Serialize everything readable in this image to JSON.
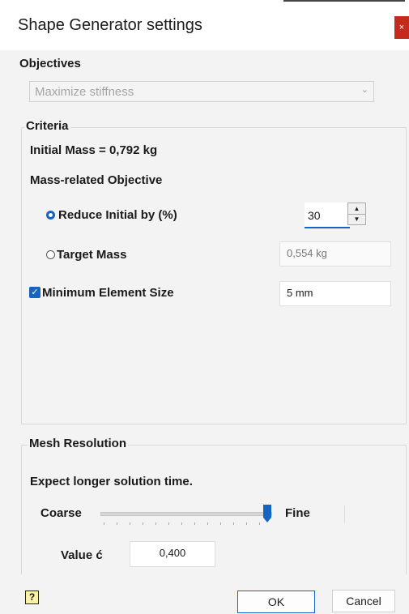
{
  "window": {
    "title": "Shape Generator settings",
    "close_symbol": "×"
  },
  "objectives": {
    "label": "Objectives",
    "selected": "Maximize stiffness",
    "chevron": "⌄"
  },
  "criteria": {
    "legend": "Criteria",
    "initial_mass": "Initial Mass = 0,792 kg",
    "mass_objective_label": "Mass-related Objective",
    "reduce_label": "Reduce Initial by (%)",
    "reduce_value": "30",
    "target_label": "Target Mass",
    "target_value": "0,554 kg",
    "min_elem_label": "Minimum Element Size",
    "min_elem_value": "5 mm",
    "check_mark": "✓"
  },
  "mesh": {
    "legend": "Mesh Resolution",
    "note": "Expect longer solution time.",
    "coarse": "Coarse",
    "fine": "Fine",
    "value_label": "Value ć",
    "value": "0,400"
  },
  "buttons": {
    "help": "?",
    "ok": "OK",
    "cancel": "Cancel"
  },
  "colors": {
    "accent": "#1464c3",
    "close": "#c42b1c"
  }
}
